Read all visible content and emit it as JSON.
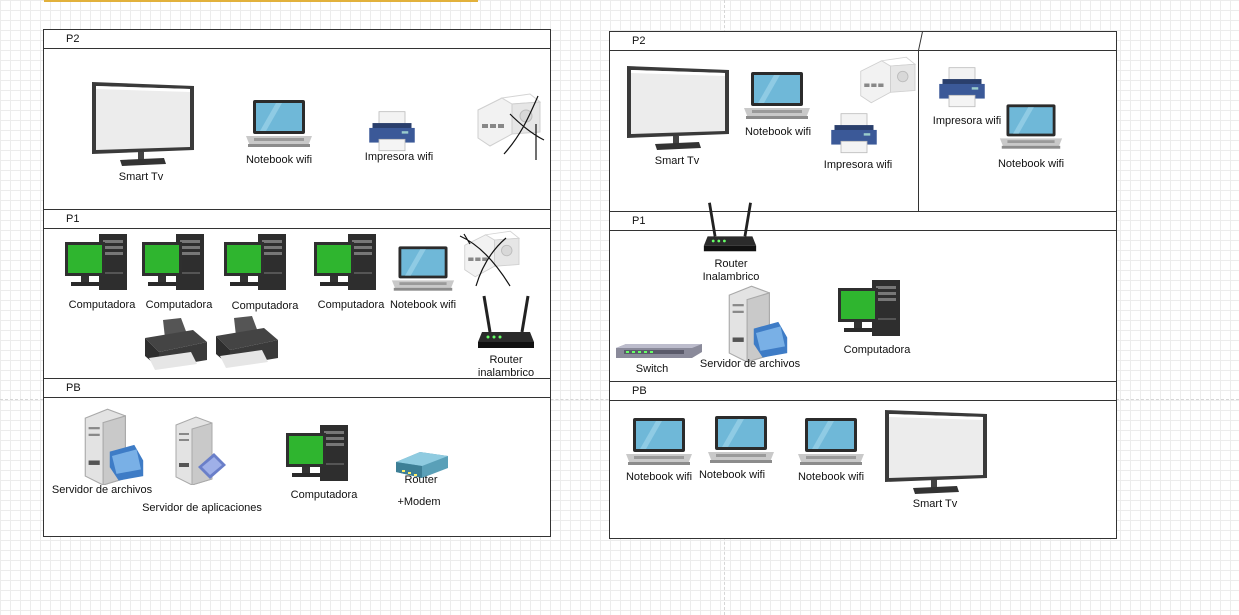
{
  "left": {
    "floors": [
      "P2",
      "P1",
      "PB"
    ],
    "p2": {
      "smart_tv": "Smart Tv",
      "notebook": "Notebook wifi",
      "printer": "Impresora wifi"
    },
    "p1": {
      "pc1": "Computadora",
      "pc2": "Computadora",
      "pc3": "Computadora",
      "pc4": "Computadora",
      "notebook": "Notebook wifi",
      "router_line1": "Router",
      "router_line2": "inalambrico"
    },
    "pb": {
      "file_server": "Servidor de archivos",
      "app_server": "Servidor de aplicaciones",
      "pc": "Computadora",
      "router_line1": "Router",
      "router_line2": "+Modem"
    }
  },
  "right": {
    "floors": [
      "P2",
      "P1",
      "PB"
    ],
    "p2": {
      "smart_tv": "Smart Tv",
      "notebook": "Notebook wifi",
      "printer": "Impresora wifi",
      "printer_b": "Impresora wifi",
      "notebook_b": "Notebook wifi"
    },
    "p1": {
      "router_line1": "Router",
      "router_line2": "Inalambrico",
      "switch": "Switch",
      "file_server": "Servidor de archivos",
      "pc": "Computadora"
    },
    "pb": {
      "notebook1": "Notebook wifi",
      "notebook2": "Notebook wifi",
      "notebook3": "Notebook wifi",
      "smart_tv": "Smart Tv"
    }
  },
  "colors": {
    "screen_green": "#2fb52f",
    "screen_blue": "#6fb8d8",
    "accent_line": "#e2b13c"
  }
}
